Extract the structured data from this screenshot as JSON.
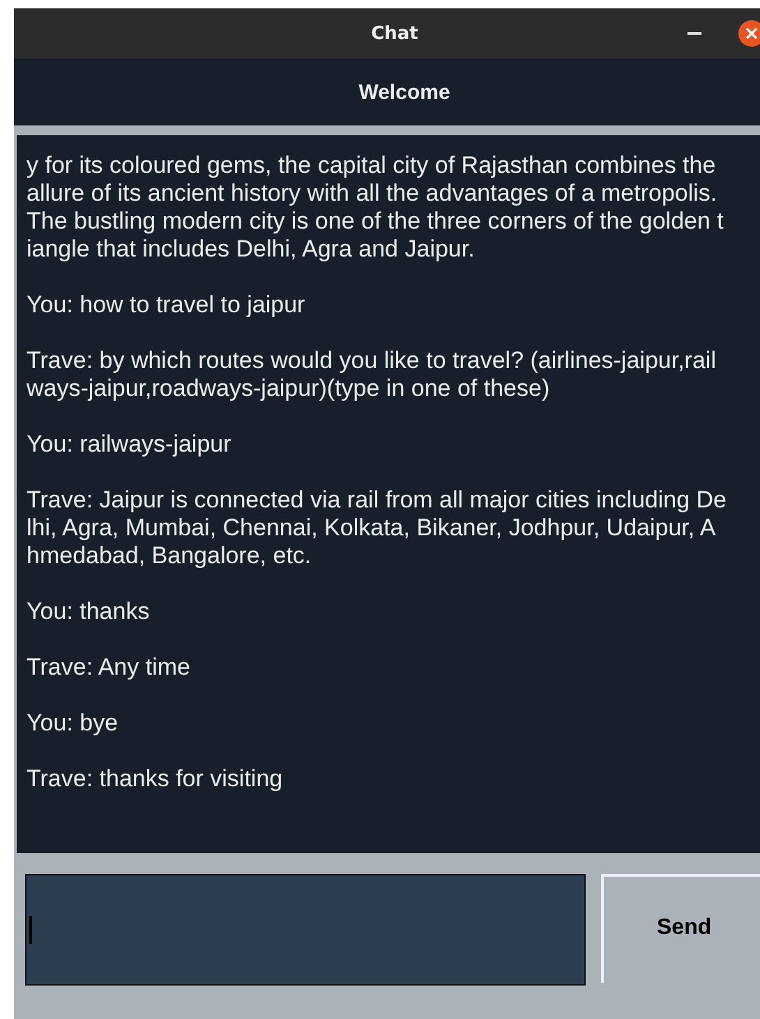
{
  "window": {
    "title": "Chat"
  },
  "header": {
    "title": "Welcome"
  },
  "messages": [
    {
      "lines": [
        "y for its coloured gems, the capital city of Rajasthan combines the",
        "allure of its ancient history with all the advantages of a metropolis.",
        "The bustling modern city is one of the three corners of the golden t",
        "iangle that includes Delhi, Agra and Jaipur."
      ]
    },
    {
      "lines": [
        "You: how to travel to jaipur"
      ]
    },
    {
      "lines": [
        "Trave: by which routes would you like to travel? (airlines-jaipur,rail",
        "ways-jaipur,roadways-jaipur)(type in one of these)"
      ]
    },
    {
      "lines": [
        "You: railways-jaipur"
      ]
    },
    {
      "lines": [
        "Trave: Jaipur is connected via rail from all major cities including De",
        "lhi, Agra, Mumbai, Chennai, Kolkata, Bikaner, Jodhpur, Udaipur, A",
        "hmedabad, Bangalore, etc."
      ]
    },
    {
      "lines": [
        "You: thanks"
      ]
    },
    {
      "lines": [
        "Trave: Any time"
      ]
    },
    {
      "lines": [
        "You: bye"
      ]
    },
    {
      "lines": [
        "Trave: thanks for visiting"
      ]
    }
  ],
  "composer": {
    "send_label": "Send"
  }
}
